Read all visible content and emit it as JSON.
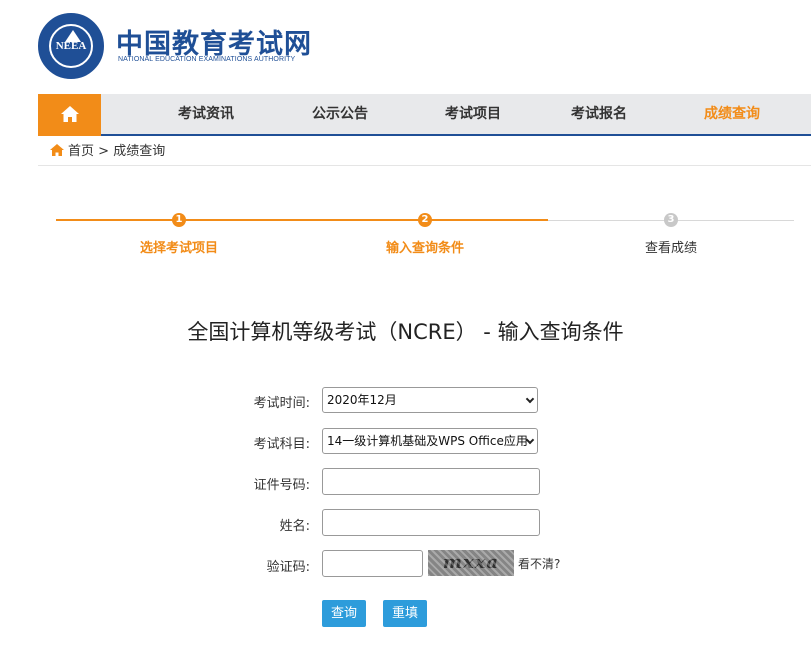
{
  "header": {
    "logo_text": "NEEA",
    "brand_cn": "中国教育考试网",
    "brand_en": "NATIONAL EDUCATION EXAMINATIONS AUTHORITY"
  },
  "nav": {
    "home_icon": "home-icon",
    "items": [
      {
        "label": "考试资讯"
      },
      {
        "label": "公示公告"
      },
      {
        "label": "考试项目"
      },
      {
        "label": "考试报名"
      },
      {
        "label": "成绩查询"
      }
    ],
    "active_index": 4
  },
  "breadcrumb": {
    "home": "首页",
    "sep": ">",
    "current": "成绩查询"
  },
  "steps": [
    {
      "num": "1",
      "label": "选择考试项目",
      "state": "done"
    },
    {
      "num": "2",
      "label": "输入查询条件",
      "state": "current"
    },
    {
      "num": "3",
      "label": "查看成绩",
      "state": "pending"
    }
  ],
  "page_title": "全国计算机等级考试（NCRE） - 输入查询条件",
  "form": {
    "exam_time_label": "考试时间:",
    "exam_time_value": "2020年12月",
    "subject_label": "考试科目:",
    "subject_value": "14一级计算机基础及WPS Office应用",
    "id_label": "证件号码:",
    "id_value": "",
    "name_label": "姓名:",
    "name_value": "",
    "captcha_label": "验证码:",
    "captcha_value": "",
    "captcha_image_text": "mxxa",
    "refresh_text": "看不清?",
    "submit_label": "查询",
    "reset_label": "重填"
  },
  "colors": {
    "brand_blue": "#1f4f96",
    "accent_orange": "#f28c18",
    "button_blue": "#2d9cdb",
    "pending_gray": "#c8c8c8"
  }
}
